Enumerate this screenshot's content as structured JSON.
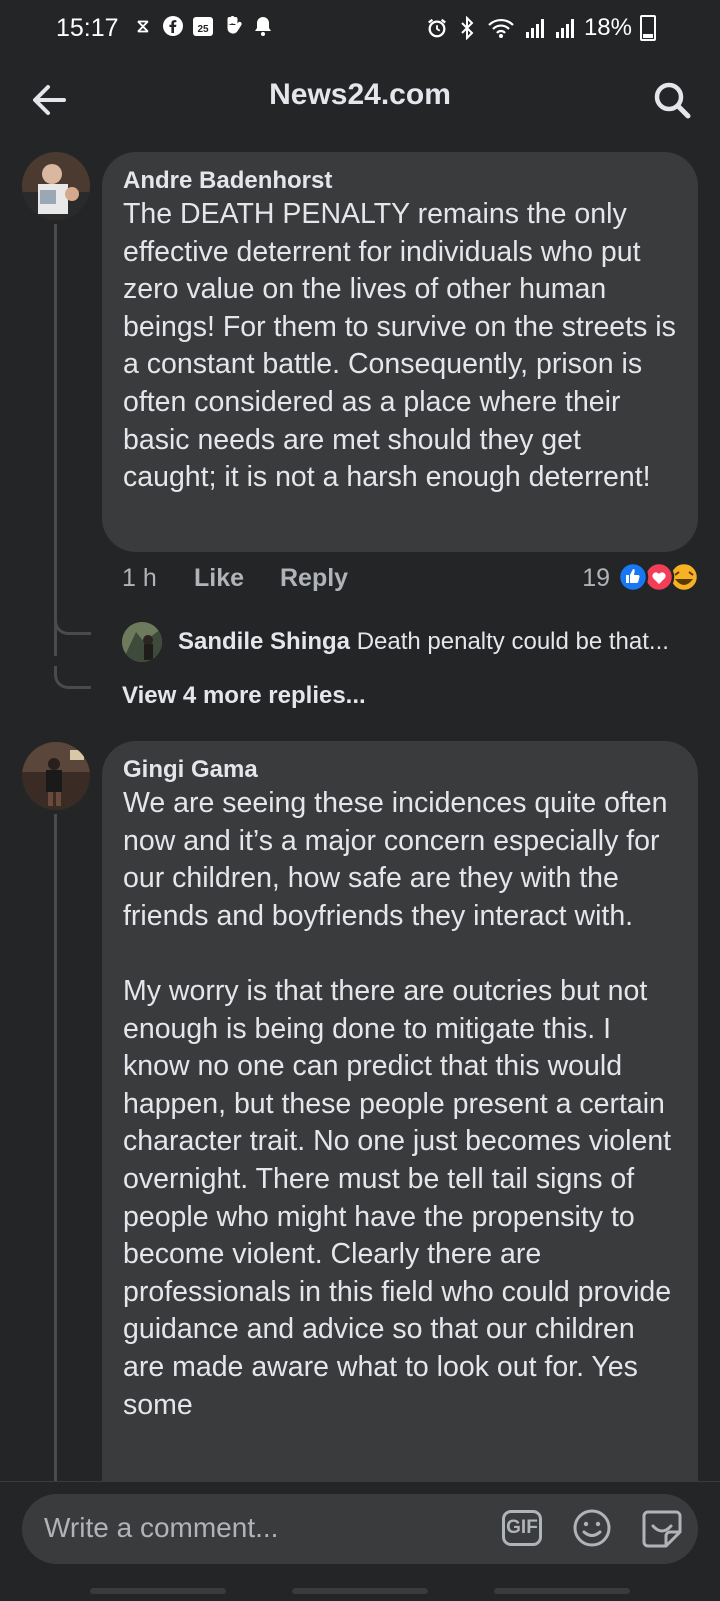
{
  "status_bar": {
    "time": "15:17",
    "calendar_date": "25",
    "battery": "18%",
    "left_icons": [
      "hourglass-icon",
      "facebook-icon",
      "calendar-icon",
      "hand-icon",
      "bell-icon"
    ],
    "right_icons": [
      "alarm-icon",
      "bluetooth-icon",
      "wifi-icon",
      "signal-icon",
      "signal-icon",
      "battery-icon"
    ]
  },
  "app_bar": {
    "title": "News24.com",
    "back_icon": "arrow-left-icon",
    "search_icon": "search-icon"
  },
  "comments": [
    {
      "author": "Andre Badenhorst",
      "text": "The DEATH PENALTY remains the only effective deterrent for individuals who put zero value on the lives of other human beings! For them to survive on the streets is a constant battle. Consequently, prison is often considered as a place where their basic needs are met should they get caught; it is not a harsh enough deterrent!",
      "time": "1 h",
      "like_label": "Like",
      "reply_label": "Reply",
      "reaction_count": "19",
      "reactions": [
        "like-reaction-icon",
        "love-reaction-icon",
        "haha-reaction-icon"
      ],
      "reply_preview": {
        "author": "Sandile Shinga",
        "text": "Death penalty could be that..."
      },
      "view_more": "View 4 more replies..."
    },
    {
      "author": "Gingi Gama",
      "text": "We are seeing these incidences quite often now and it’s a major concern especially for our children, how safe are they with the friends and boyfriends they interact with.\n\nMy worry is that there are outcries but not enough is being done to mitigate this. I know no one can predict that this would happen, but these people present a certain character trait. No one just becomes violent overnight. There must be tell  tail signs of people who might have the propensity to become violent. Clearly there are professionals in this field who could provide guidance and advice so that our children are made aware what to look out for. Yes some"
    }
  ],
  "composer": {
    "placeholder": "Write a comment...",
    "gif_label": "GIF",
    "emoji_icon": "emoji-icon",
    "sticker_icon": "sticker-icon"
  },
  "colors": {
    "background": "#242526",
    "bubble": "#3a3b3c",
    "text": "#e4e6eb",
    "secondary_text": "#b0b3b8",
    "like_blue": "#1877f2",
    "love_red": "#f33e58",
    "haha_yellow": "#f7b125"
  }
}
